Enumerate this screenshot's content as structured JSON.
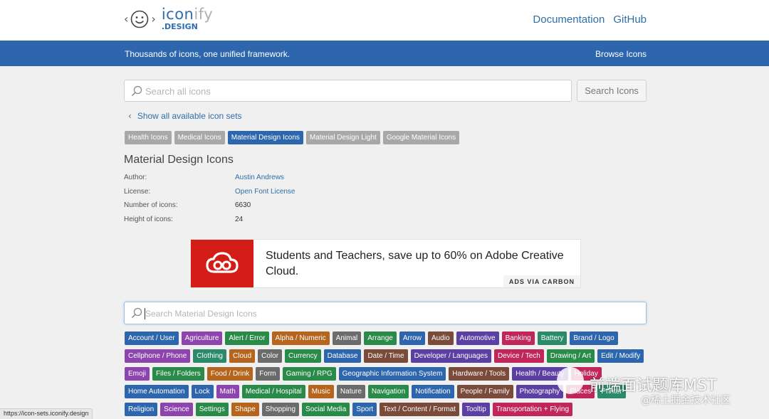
{
  "logo": {
    "name_part1": "icon",
    "name_part2": "ify",
    "subtitle": ".DESIGN"
  },
  "nav": {
    "documentation": "Documentation",
    "github": "GitHub"
  },
  "banner": {
    "tagline": "Thousands of icons, one unified framework.",
    "browse": "Browse Icons"
  },
  "search": {
    "placeholder": "Search all icons",
    "button": "Search Icons"
  },
  "show_all": "Show all available icon sets",
  "icon_sets": [
    {
      "label": "Health Icons",
      "active": false
    },
    {
      "label": "Medical Icons",
      "active": false
    },
    {
      "label": "Material Design Icons",
      "active": true
    },
    {
      "label": "Material Design Light",
      "active": false
    },
    {
      "label": "Google Material Icons",
      "active": false
    }
  ],
  "set": {
    "title": "Material Design Icons",
    "author_label": "Author:",
    "author": "Austin Andrews",
    "license_label": "License:",
    "license": "Open Font License",
    "count_label": "Number of icons:",
    "count": "6630",
    "height_label": "Height of icons:",
    "height": "24"
  },
  "ad": {
    "text": "Students and Teachers, save up to 60% on Adobe Creative Cloud.",
    "via": "ADS VIA CARBON"
  },
  "set_search": {
    "placeholder": "Search Material Design Icons"
  },
  "categories": [
    {
      "label": "Account / User",
      "color": "#2d66ad"
    },
    {
      "label": "Agriculture",
      "color": "#8e44ad"
    },
    {
      "label": "Alert / Error",
      "color": "#2a8a4a"
    },
    {
      "label": "Alpha / Numeric",
      "color": "#b5651d"
    },
    {
      "label": "Animal",
      "color": "#6b6b6b"
    },
    {
      "label": "Arrange",
      "color": "#2a8a4a"
    },
    {
      "label": "Arrow",
      "color": "#2d66ad"
    },
    {
      "label": "Audio",
      "color": "#7a4a3a"
    },
    {
      "label": "Automotive",
      "color": "#5b3fa3"
    },
    {
      "label": "Banking",
      "color": "#c0265a"
    },
    {
      "label": "Battery",
      "color": "#2a8a6a"
    },
    {
      "label": "Brand / Logo",
      "color": "#2d66ad"
    },
    {
      "label": "Cellphone / Phone",
      "color": "#8e44ad"
    },
    {
      "label": "Clothing",
      "color": "#2a8a6a"
    },
    {
      "label": "Cloud",
      "color": "#b5651d"
    },
    {
      "label": "Color",
      "color": "#6b6b6b"
    },
    {
      "label": "Currency",
      "color": "#2a8a4a"
    },
    {
      "label": "Database",
      "color": "#2d66ad"
    },
    {
      "label": "Date / Time",
      "color": "#7a4a3a"
    },
    {
      "label": "Developer / Languages",
      "color": "#5b3fa3"
    },
    {
      "label": "Device / Tech",
      "color": "#c0265a"
    },
    {
      "label": "Drawing / Art",
      "color": "#2a8a4a"
    },
    {
      "label": "Edit / Modify",
      "color": "#2d66ad"
    },
    {
      "label": "Emoji",
      "color": "#8e44ad"
    },
    {
      "label": "Files / Folders",
      "color": "#2a8a4a"
    },
    {
      "label": "Food / Drink",
      "color": "#b5651d"
    },
    {
      "label": "Form",
      "color": "#6b6b6b"
    },
    {
      "label": "Gaming / RPG",
      "color": "#2a8a4a"
    },
    {
      "label": "Geographic Information System",
      "color": "#2d66ad"
    },
    {
      "label": "Hardware / Tools",
      "color": "#7a4a3a"
    },
    {
      "label": "Health / Beauty",
      "color": "#5b3fa3"
    },
    {
      "label": "Holiday",
      "color": "#c0265a"
    },
    {
      "label": "Home Automation",
      "color": "#2d66ad"
    },
    {
      "label": "Lock",
      "color": "#2d66ad"
    },
    {
      "label": "Math",
      "color": "#8e44ad"
    },
    {
      "label": "Medical / Hospital",
      "color": "#2a8a4a"
    },
    {
      "label": "Music",
      "color": "#b5651d"
    },
    {
      "label": "Nature",
      "color": "#6b6b6b"
    },
    {
      "label": "Navigation",
      "color": "#2a8a4a"
    },
    {
      "label": "Notification",
      "color": "#2d66ad"
    },
    {
      "label": "People / Family",
      "color": "#7a4a3a"
    },
    {
      "label": "Photography",
      "color": "#5b3fa3"
    },
    {
      "label": "Places",
      "color": "#c0265a"
    },
    {
      "label": "Printer",
      "color": "#2a8a6a"
    },
    {
      "label": "Religion",
      "color": "#2d66ad"
    },
    {
      "label": "Science",
      "color": "#8e44ad"
    },
    {
      "label": "Settings",
      "color": "#2a8a4a"
    },
    {
      "label": "Shape",
      "color": "#b5651d"
    },
    {
      "label": "Shopping",
      "color": "#6b6b6b"
    },
    {
      "label": "Social Media",
      "color": "#2a8a4a"
    },
    {
      "label": "Sport",
      "color": "#2d66ad"
    },
    {
      "label": "Text / Content / Format",
      "color": "#7a4a3a"
    },
    {
      "label": "Tooltip",
      "color": "#5b3fa3"
    },
    {
      "label": "Transportation + Flying",
      "color": "#c0265a"
    }
  ],
  "status_url": "https://icon-sets.iconify.design",
  "watermark": {
    "title": "前端面试题库MST",
    "subtitle": "@稀土掘金技术社区"
  }
}
